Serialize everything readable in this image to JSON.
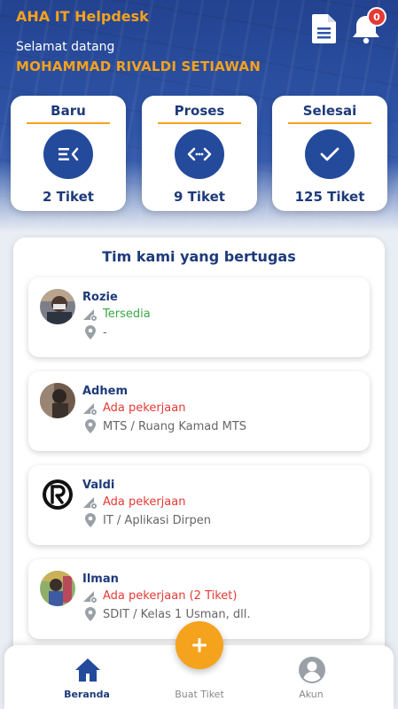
{
  "header": {
    "app_title": "AHA IT Helpdesk",
    "welcome": "Selamat datang",
    "user_name": "MOHAMMAD RIVALDI SETIAWAN",
    "notification_count": "0",
    "doc_icon": "document-icon",
    "bell_icon": "bell-icon"
  },
  "stats": [
    {
      "title": "Baru",
      "count": "2 Tiket",
      "icon": "queue-icon"
    },
    {
      "title": "Proses",
      "count": "9 Tiket",
      "icon": "code-arrows-icon"
    },
    {
      "title": "Selesai",
      "count": "125 Tiket",
      "icon": "check-icon"
    }
  ],
  "team": {
    "title": "Tim kami yang bertugas",
    "members": [
      {
        "name": "Rozie",
        "status": "Tersedia",
        "location": "-"
      },
      {
        "name": "Adhem",
        "status": "Ada pekerjaan",
        "location": "MTS / Ruang Kamad MTS"
      },
      {
        "name": "Valdi",
        "status": "Ada pekerjaan",
        "location": "IT / Aplikasi Dirpen"
      },
      {
        "name": "Ilman",
        "status": "Ada pekerjaan (2 Tiket)",
        "location": "SDIT / Kelas 1 Usman, dll."
      }
    ]
  },
  "nav": {
    "home": "Beranda",
    "create": "Buat Tiket",
    "account": "Akun"
  },
  "colors": {
    "accent": "#f5a21d",
    "primary": "#244a9c",
    "available": "#3aa845",
    "busy": "#e53935"
  }
}
